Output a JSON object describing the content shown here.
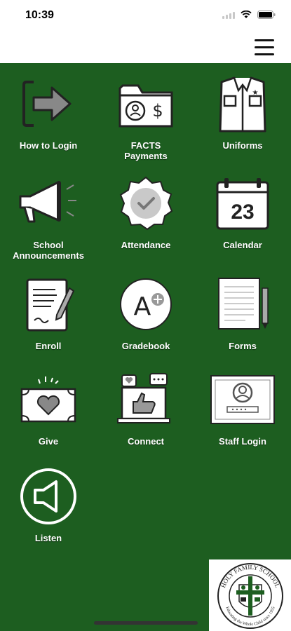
{
  "status_bar": {
    "time": "10:39"
  },
  "header": {
    "menu_icon": "hamburger-menu-icon"
  },
  "colors": {
    "background": "#1d5e20",
    "tile_text": "#ffffff",
    "icon_fill": "#ffffff",
    "icon_stroke": "#222222"
  },
  "tiles": [
    {
      "label": "How to Login",
      "icon": "login-arrow-icon"
    },
    {
      "label": "FACTS\nPayments",
      "icon": "payments-folder-icon"
    },
    {
      "label": "Uniforms",
      "icon": "uniform-shirt-icon"
    },
    {
      "label": "School\nAnnouncements",
      "icon": "megaphone-icon"
    },
    {
      "label": "Attendance",
      "icon": "checkmark-badge-icon"
    },
    {
      "label": "Calendar",
      "icon": "calendar-icon",
      "day": "23"
    },
    {
      "label": "Enroll",
      "icon": "enroll-document-icon"
    },
    {
      "label": "Gradebook",
      "icon": "gradebook-grade-icon",
      "grade": "A"
    },
    {
      "label": "Forms",
      "icon": "forms-document-icon"
    },
    {
      "label": "Give",
      "icon": "donation-heart-icon"
    },
    {
      "label": "Connect",
      "icon": "social-connect-icon"
    },
    {
      "label": "Staff Login",
      "icon": "staff-login-icon"
    },
    {
      "label": "Listen",
      "icon": "speaker-icon"
    }
  ],
  "logo": {
    "text": "HOLY FAMILY SCHOOL",
    "motto": "Educating the Whole Child since 1955"
  }
}
